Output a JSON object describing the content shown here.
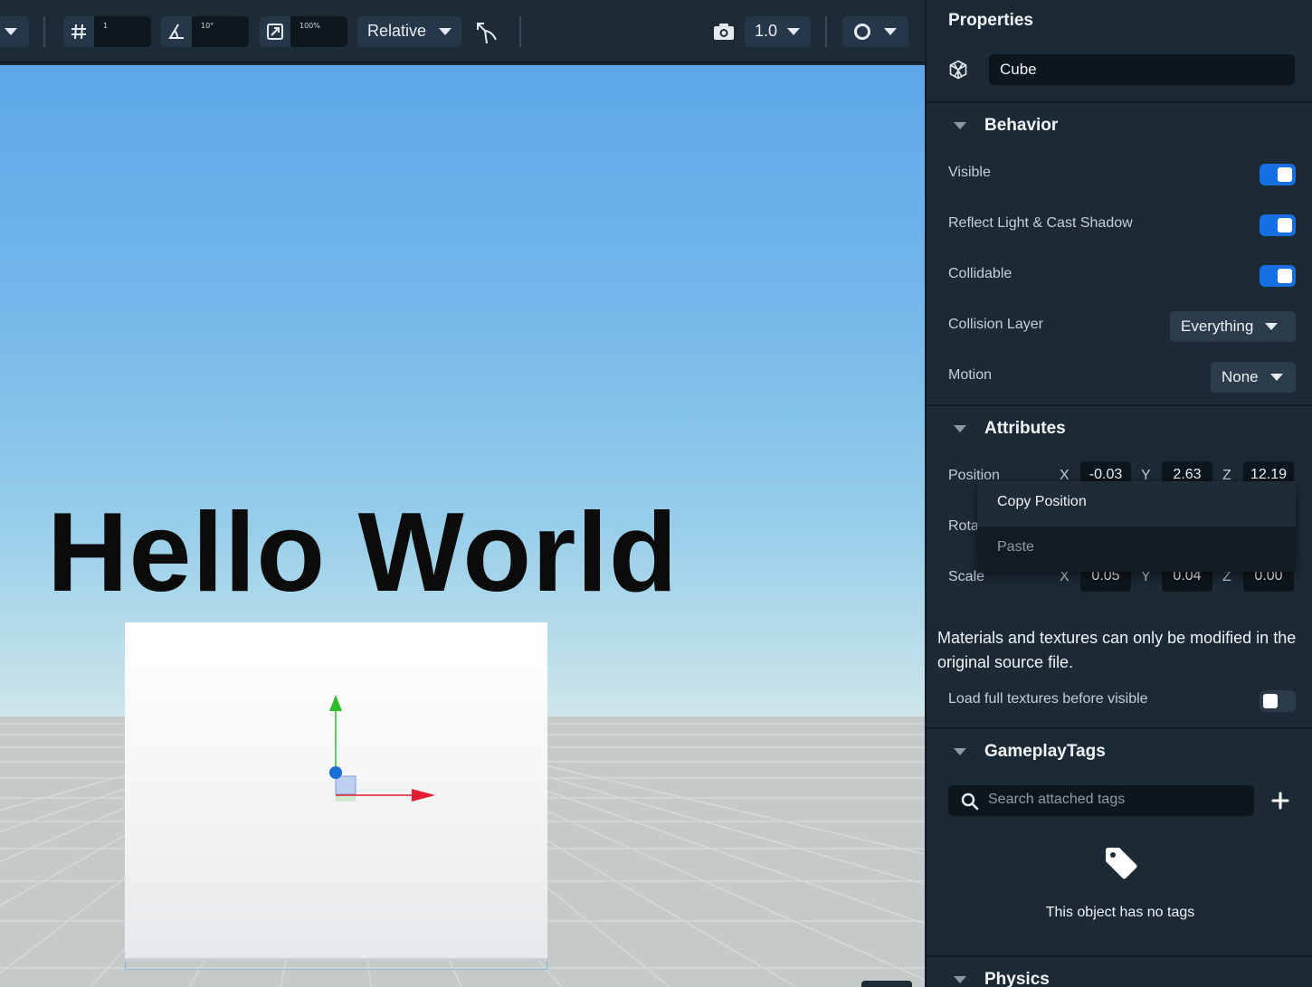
{
  "toolbar": {
    "grid_value": "1",
    "angle_value": "10°",
    "scale_value": "100%",
    "space_mode": "Relative",
    "camera_speed": "1.0",
    "icons": [
      "dropdown-icon",
      "grid-icon",
      "angle-snap-icon",
      "scale-snap-icon",
      "pivot-icon",
      "camera-icon",
      "lighting-icon"
    ]
  },
  "viewport": {
    "scene_text": "Hello World",
    "colors": {
      "x_axis": "#e11d2f",
      "y_axis": "#2bc02b",
      "pivot": "#1c6fd6"
    }
  },
  "panel": {
    "title": "Properties",
    "object_name": "Cube",
    "object_icon": "cube-icon",
    "behavior": {
      "title": "Behavior",
      "visible_label": "Visible",
      "visible_on": true,
      "reflect_label": "Reflect Light & Cast Shadow",
      "reflect_on": true,
      "collidable_label": "Collidable",
      "collidable_on": true,
      "collision_layer_label": "Collision Layer",
      "collision_layer_value": "Everything",
      "motion_label": "Motion",
      "motion_value": "None"
    },
    "attributes": {
      "title": "Attributes",
      "position_label": "Position",
      "rotation_label": "Rota",
      "scale_label": "Scale",
      "axis_x": "X",
      "axis_y": "Y",
      "axis_z": "Z",
      "position": {
        "x": "-0.03",
        "y": "2.63",
        "z": "12.19"
      },
      "scale": {
        "x": "0.05",
        "y": "0.04",
        "z": "0.00"
      }
    },
    "context_menu": {
      "copy": "Copy Position",
      "paste": "Paste"
    },
    "materials_note": "Materials and textures can only be modified in the original source file.",
    "load_textures_label": "Load full textures before visible",
    "load_textures_on": false,
    "gameplay_tags": {
      "title": "GameplayTags",
      "search_placeholder": "Search attached tags",
      "empty_text": "This object has no tags"
    },
    "physics_title": "Physics",
    "accent_color": "#1670e4"
  }
}
